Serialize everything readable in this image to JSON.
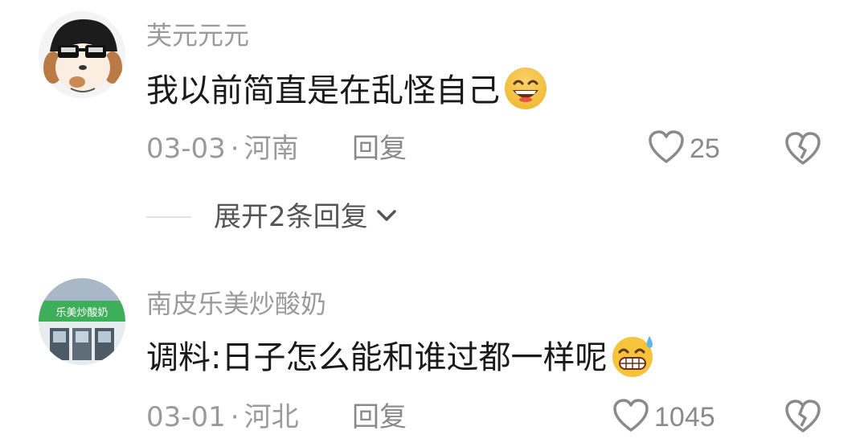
{
  "comments": [
    {
      "username": "芙元元元",
      "text": "我以前简直是在乱怪自己",
      "emoji": "grinning-face-emoji",
      "date": "03-03",
      "separator": "·",
      "location": "河南",
      "reply_label": "回复",
      "likes": "25"
    },
    {
      "username": "南皮乐美炒酸奶",
      "text": "调料:日子怎么能和谁过都一样呢",
      "emoji": "grinning-face-with-sweat-emoji",
      "avatar_sign_text": "乐美炒酸奶",
      "date": "03-01",
      "separator": "·",
      "location": "河北",
      "reply_label": "回复",
      "likes": "1045"
    }
  ],
  "expand_replies": {
    "label": "展开2条回复"
  },
  "colors": {
    "meta_text": "#9a9a9a",
    "body_text": "#1a1a1a",
    "icon_stroke": "#8a8a8a",
    "emoji_face": "#f7c23c"
  },
  "icons": [
    "heart-icon",
    "broken-heart-icon",
    "chevron-down-icon"
  ]
}
